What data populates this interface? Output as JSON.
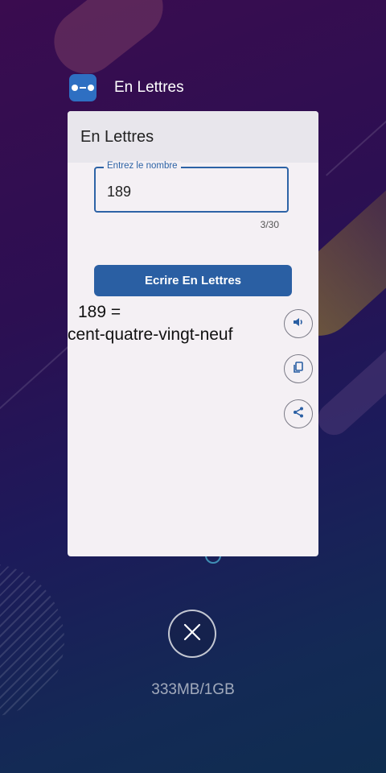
{
  "app": {
    "name": "En Lettres",
    "window_title": "En Lettres"
  },
  "input": {
    "label": "Entrez le nombre",
    "value": "189",
    "counter": "3/30"
  },
  "button": {
    "label": "Ecrire En Lettres"
  },
  "result": {
    "number_line": "189 =",
    "words_line": "cent-quatre-vingt-neuf"
  },
  "actions": [
    {
      "name": "speaker-icon"
    },
    {
      "name": "copy-icon"
    },
    {
      "name": "share-icon"
    }
  ],
  "recents": {
    "memory": "333MB/1GB"
  },
  "colors": {
    "accent": "#2a5fa3",
    "card_bg": "#f4f0f4",
    "titlebar_bg": "#e8e6ec"
  }
}
